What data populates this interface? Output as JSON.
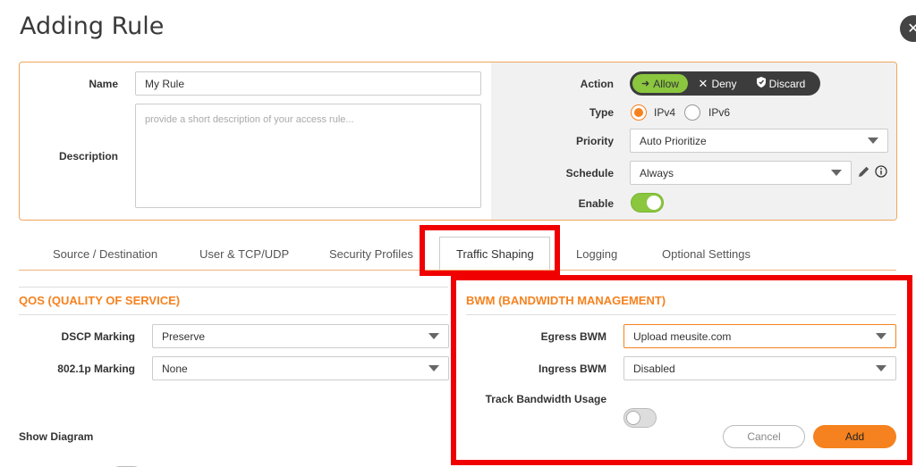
{
  "dialog": {
    "title": "Adding Rule",
    "close_glyph": "✕"
  },
  "general": {
    "name_label": "Name",
    "name_value": "My Rule",
    "description_label": "Description",
    "description_placeholder": "provide a short description of your access rule...",
    "action_label": "Action",
    "actions": [
      "Allow",
      "Deny",
      "Discard"
    ],
    "action_selected": "Allow",
    "type_label": "Type",
    "types": [
      "IPv4",
      "IPv6"
    ],
    "type_selected": "IPv4",
    "priority_label": "Priority",
    "priority_value": "Auto Prioritize",
    "schedule_label": "Schedule",
    "schedule_value": "Always",
    "enable_label": "Enable",
    "enable_on": true
  },
  "tabs": {
    "items": [
      "Source / Destination",
      "User & TCP/UDP",
      "Security Profiles",
      "Traffic Shaping",
      "Logging",
      "Optional Settings"
    ],
    "active": "Traffic Shaping"
  },
  "qos": {
    "title": "QOS (QUALITY OF SERVICE)",
    "dscp_label": "DSCP Marking",
    "dscp_value": "Preserve",
    "dot1p_label": "802.1p Marking",
    "dot1p_value": "None"
  },
  "bwm": {
    "title": "BWM (BANDWIDTH MANAGEMENT)",
    "egress_label": "Egress BWM",
    "egress_value": "Upload meusite.com",
    "ingress_label": "Ingress BWM",
    "ingress_value": "Disabled",
    "track_label": "Track Bandwidth Usage",
    "track_on": false
  },
  "footer": {
    "show_diagram_label": "Show Diagram",
    "show_diagram_on": false,
    "cancel_label": "Cancel",
    "add_label": "Add"
  },
  "colors": {
    "accent_orange": "#f5821f",
    "allow_green": "#8bc63f",
    "highlight_red": "#f00000",
    "panel_border": "#f0a55c"
  }
}
